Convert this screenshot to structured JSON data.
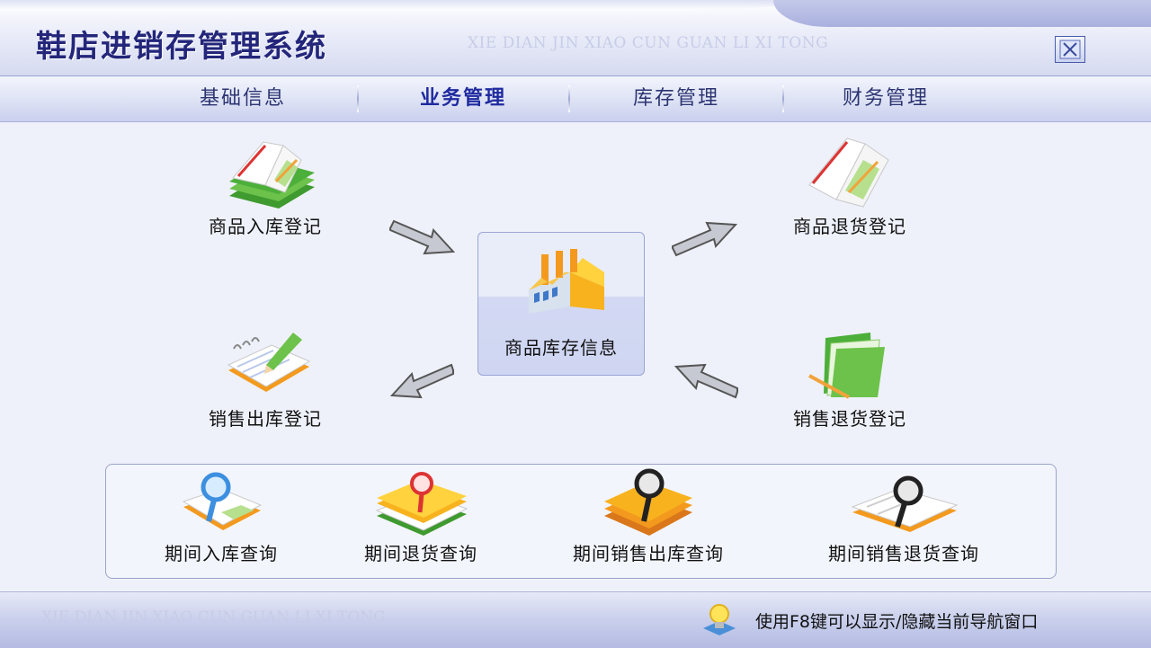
{
  "window": {
    "title": "鞋店进销存管理系统",
    "watermark": "XIE DIAN JIN XIAO CUN GUAN LI XI TONG"
  },
  "menu": [
    {
      "label": "基础信息",
      "active": false
    },
    {
      "label": "业务管理",
      "active": true
    },
    {
      "label": "库存管理",
      "active": false
    },
    {
      "label": "财务管理",
      "active": false
    }
  ],
  "modules": {
    "goods_in": "商品入库登记",
    "goods_return": "商品退货登记",
    "stock_info": "商品库存信息",
    "sales_out": "销售出库登记",
    "sales_return": "销售退货登记"
  },
  "queries": [
    {
      "label": "期间入库查询"
    },
    {
      "label": "期间退货查询"
    },
    {
      "label": "期间销售出库查询"
    },
    {
      "label": "期间销售退货查询"
    }
  ],
  "status": {
    "watermark": "XIE DIAN JIN XIAO CUN GUAN LI XI TONG",
    "hint": "使用F8键可以显示/隐藏当前导航窗口"
  },
  "colors": {
    "title_text": "#23267a",
    "menu_text": "#2c3472",
    "menu_active": "#1f2aa0",
    "icon_green": "#4caf3a",
    "icon_orange": "#f39a1e"
  },
  "icons": {
    "close": "close-icon",
    "goods_in": "green-book-icon",
    "goods_return": "open-book-icon",
    "stock_info": "factory-icon",
    "sales_out": "notepad-pencil-icon",
    "sales_return": "green-folder-icon",
    "query": "magnifier-book-icon",
    "hint": "lightbulb-icon"
  }
}
